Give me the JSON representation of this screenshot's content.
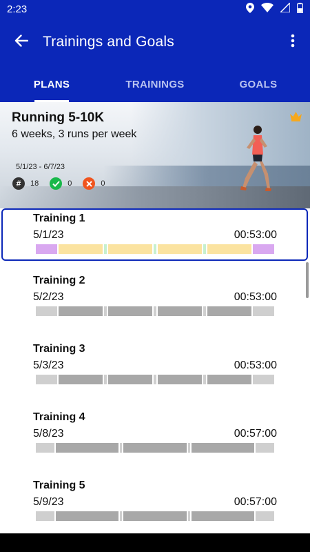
{
  "status_bar": {
    "time": "2:23",
    "icons": [
      "location-icon",
      "wifi-icon",
      "signal-icon",
      "battery-icon"
    ]
  },
  "app_bar": {
    "title": "Trainings and Goals",
    "back_icon": "arrow-back-icon",
    "menu_icon": "more-vert-icon"
  },
  "tabs": [
    {
      "label": "PLANS",
      "active": true
    },
    {
      "label": "TRAININGS",
      "active": false
    },
    {
      "label": "GOALS",
      "active": false
    }
  ],
  "plan": {
    "title": "Running 5-10K",
    "subtitle": "6 weeks, 3 runs per week",
    "dates": "5/1/23 - 6/7/23",
    "stats": [
      {
        "icon": "hash-icon",
        "value": "18",
        "color": "#333333"
      },
      {
        "icon": "check-icon",
        "value": "0",
        "color": "#18b84a"
      },
      {
        "icon": "cross-icon",
        "value": "0",
        "color": "#f0541e"
      }
    ],
    "premium_icon": "crown-icon"
  },
  "colors": {
    "primary": "#0b27b8",
    "warmup": "#d9a8f0",
    "run": "#fbe3a0",
    "walk": "#c7f0cf",
    "inactive_light": "#cfcfcf",
    "inactive_dark": "#a8a8a8"
  },
  "trainings": [
    {
      "name": "Training 1",
      "date": "5/1/23",
      "duration": "00:53:00",
      "selected": true,
      "segments": [
        {
          "w": 9,
          "c": "warmup"
        },
        {
          "w": 19,
          "c": "run"
        },
        {
          "w": 1,
          "c": "walk"
        },
        {
          "w": 19,
          "c": "run"
        },
        {
          "w": 1,
          "c": "walk"
        },
        {
          "w": 19,
          "c": "run"
        },
        {
          "w": 1,
          "c": "walk"
        },
        {
          "w": 19,
          "c": "run"
        },
        {
          "w": 9,
          "c": "warmup"
        }
      ]
    },
    {
      "name": "Training 2",
      "date": "5/2/23",
      "duration": "00:53:00",
      "selected": false,
      "segments": [
        {
          "w": 9,
          "c": "inactive_light"
        },
        {
          "w": 19,
          "c": "inactive_dark"
        },
        {
          "w": 1,
          "c": "inactive_light"
        },
        {
          "w": 19,
          "c": "inactive_dark"
        },
        {
          "w": 1,
          "c": "inactive_light"
        },
        {
          "w": 19,
          "c": "inactive_dark"
        },
        {
          "w": 1,
          "c": "inactive_light"
        },
        {
          "w": 19,
          "c": "inactive_dark"
        },
        {
          "w": 9,
          "c": "inactive_light"
        }
      ]
    },
    {
      "name": "Training 3",
      "date": "5/3/23",
      "duration": "00:53:00",
      "selected": false,
      "segments": [
        {
          "w": 9,
          "c": "inactive_light"
        },
        {
          "w": 19,
          "c": "inactive_dark"
        },
        {
          "w": 1,
          "c": "inactive_light"
        },
        {
          "w": 19,
          "c": "inactive_dark"
        },
        {
          "w": 1,
          "c": "inactive_light"
        },
        {
          "w": 19,
          "c": "inactive_dark"
        },
        {
          "w": 1,
          "c": "inactive_light"
        },
        {
          "w": 19,
          "c": "inactive_dark"
        },
        {
          "w": 9,
          "c": "inactive_light"
        }
      ]
    },
    {
      "name": "Training 4",
      "date": "5/8/23",
      "duration": "00:57:00",
      "selected": false,
      "segments": [
        {
          "w": 8,
          "c": "inactive_light"
        },
        {
          "w": 27,
          "c": "inactive_dark"
        },
        {
          "w": 1,
          "c": "inactive_light"
        },
        {
          "w": 27,
          "c": "inactive_dark"
        },
        {
          "w": 1,
          "c": "inactive_light"
        },
        {
          "w": 27,
          "c": "inactive_dark"
        },
        {
          "w": 8,
          "c": "inactive_light"
        }
      ]
    },
    {
      "name": "Training 5",
      "date": "5/9/23",
      "duration": "00:57:00",
      "selected": false,
      "segments": [
        {
          "w": 8,
          "c": "inactive_light"
        },
        {
          "w": 27,
          "c": "inactive_dark"
        },
        {
          "w": 1,
          "c": "inactive_light"
        },
        {
          "w": 27,
          "c": "inactive_dark"
        },
        {
          "w": 1,
          "c": "inactive_light"
        },
        {
          "w": 27,
          "c": "inactive_dark"
        },
        {
          "w": 8,
          "c": "inactive_light"
        }
      ]
    }
  ]
}
